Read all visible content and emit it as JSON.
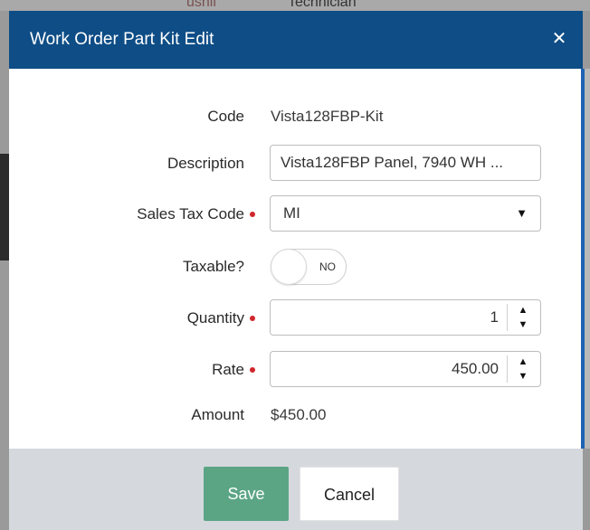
{
  "background": {
    "top_text_left": "ushii",
    "top_text_right": "Technician"
  },
  "modal": {
    "title": "Work Order Part Kit Edit",
    "close_glyph": "✕"
  },
  "form": {
    "code": {
      "label": "Code",
      "value": "Vista128FBP-Kit"
    },
    "description": {
      "label": "Description",
      "value": "Vista128FBP Panel, 7940 WH ..."
    },
    "sales_tax_code": {
      "label": "Sales Tax Code",
      "value": "MI",
      "required": true
    },
    "taxable": {
      "label": "Taxable?",
      "state_text": "NO"
    },
    "quantity": {
      "label": "Quantity",
      "value": "1",
      "required": true
    },
    "rate": {
      "label": "Rate",
      "value": "450.00",
      "required": true
    },
    "amount": {
      "label": "Amount",
      "value": "$450.00"
    }
  },
  "footer": {
    "save_label": "Save",
    "cancel_label": "Cancel"
  },
  "icons": {
    "close": "close-icon",
    "dropdown": "chevron-down-icon",
    "spin_up": "caret-up-icon",
    "spin_down": "caret-down-icon"
  },
  "colors": {
    "header": "#0e4d86",
    "save_button": "#5ba585",
    "required_dot": "#d0262c",
    "footer_bg": "#d5d9de"
  }
}
